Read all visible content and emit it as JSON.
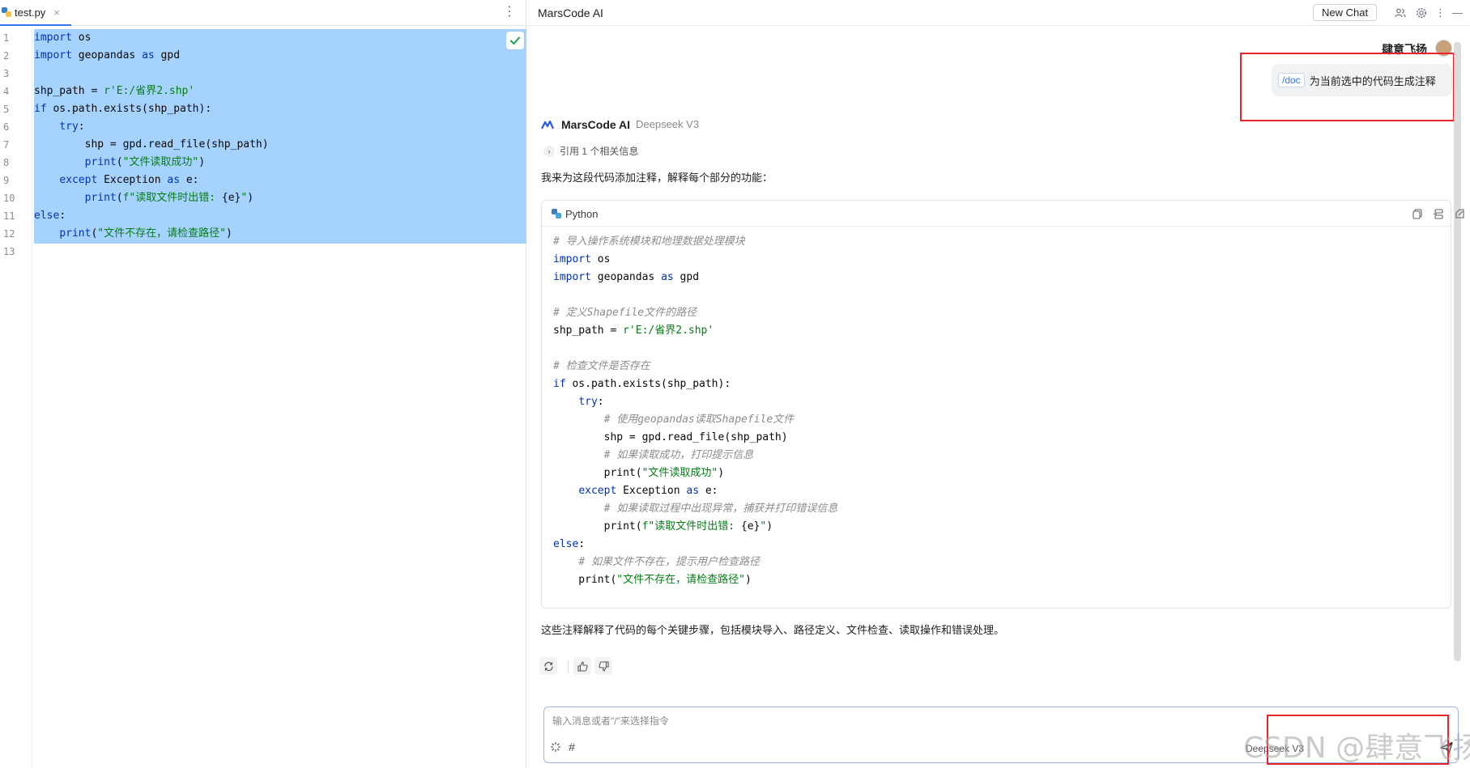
{
  "editor": {
    "tab_label": "test.py",
    "close_glyph": "×",
    "more_glyph": "⋮",
    "line_numbers": [
      "1",
      "2",
      "3",
      "4",
      "5",
      "6",
      "7",
      "8",
      "9",
      "10",
      "11",
      "12",
      "13"
    ],
    "lines": [
      [
        {
          "t": "import",
          "c": "kw"
        },
        {
          "t": " os"
        }
      ],
      [
        {
          "t": "import",
          "c": "kw"
        },
        {
          "t": " geopandas "
        },
        {
          "t": "as",
          "c": "kw"
        },
        {
          "t": " gpd"
        }
      ],
      [],
      [
        {
          "t": "shp_path = "
        },
        {
          "t": "r'E:/省界2.shp'",
          "c": "str"
        }
      ],
      [
        {
          "t": "if",
          "c": "kw"
        },
        {
          "t": " os.path.exists(shp_path):"
        }
      ],
      [
        {
          "t": "    "
        },
        {
          "t": "try",
          "c": "kw"
        },
        {
          "t": ":"
        }
      ],
      [
        {
          "t": "        shp = gpd.read_file(shp_path)"
        }
      ],
      [
        {
          "t": "        "
        },
        {
          "t": "print",
          "c": "kw"
        },
        {
          "t": "("
        },
        {
          "t": "\"文件读取成功\"",
          "c": "str"
        },
        {
          "t": ")"
        }
      ],
      [
        {
          "t": "    "
        },
        {
          "t": "except",
          "c": "kw"
        },
        {
          "t": " Exception "
        },
        {
          "t": "as",
          "c": "kw"
        },
        {
          "t": " e:"
        }
      ],
      [
        {
          "t": "        "
        },
        {
          "t": "print",
          "c": "kw"
        },
        {
          "t": "("
        },
        {
          "t": "f\"读取文件时出错: ",
          "c": "str"
        },
        {
          "t": "{e}"
        },
        {
          "t": "\"",
          "c": "str"
        },
        {
          "t": ")"
        }
      ],
      [
        {
          "t": "else",
          "c": "kw"
        },
        {
          "t": ":"
        }
      ],
      [
        {
          "t": "    "
        },
        {
          "t": "print",
          "c": "kw"
        },
        {
          "t": "("
        },
        {
          "t": "\"文件不存在，请检查路径\"",
          "c": "str"
        },
        {
          "t": ")"
        }
      ],
      []
    ]
  },
  "chat": {
    "panel_title": "MarsCode AI",
    "new_chat_label": "New Chat",
    "header_icons": [
      "people-icon",
      "gear-icon",
      "more-icon",
      "minimize-icon"
    ],
    "user": {
      "name": "肆意飞扬",
      "command_chip": "/doc",
      "message": "为当前选中的代码生成注释"
    },
    "assistant": {
      "name": "MarsCode AI",
      "model": "Deepseek V3",
      "reference_label": "引用 1 个相关信息",
      "intro": "我来为这段代码添加注释，解释每个部分的功能：",
      "code_language": "Python",
      "code_lines": [
        [
          {
            "t": "# 导入操作系统模块和地理数据处理模块",
            "c": "cmt"
          }
        ],
        [
          {
            "t": "import",
            "c": "kw"
          },
          {
            "t": " os"
          }
        ],
        [
          {
            "t": "import",
            "c": "kw"
          },
          {
            "t": " geopandas "
          },
          {
            "t": "as",
            "c": "kw"
          },
          {
            "t": " gpd"
          }
        ],
        [],
        [
          {
            "t": "# 定义Shapefile文件的路径",
            "c": "cmt"
          }
        ],
        [
          {
            "t": "shp_path = "
          },
          {
            "t": "r'E:/省界2.shp'",
            "c": "str"
          }
        ],
        [],
        [
          {
            "t": "# 检查文件是否存在",
            "c": "cmt"
          }
        ],
        [
          {
            "t": "if",
            "c": "kw"
          },
          {
            "t": " os.path.exists(shp_path):"
          }
        ],
        [
          {
            "t": "    "
          },
          {
            "t": "try",
            "c": "kw"
          },
          {
            "t": ":"
          }
        ],
        [
          {
            "t": "        "
          },
          {
            "t": "# 使用geopandas读取Shapefile文件",
            "c": "cmt"
          }
        ],
        [
          {
            "t": "        shp = gpd.read_file(shp_path)"
          }
        ],
        [
          {
            "t": "        "
          },
          {
            "t": "# 如果读取成功，打印提示信息",
            "c": "cmt"
          }
        ],
        [
          {
            "t": "        print("
          },
          {
            "t": "\"文件读取成功\"",
            "c": "str"
          },
          {
            "t": ")"
          }
        ],
        [
          {
            "t": "    "
          },
          {
            "t": "except",
            "c": "kw"
          },
          {
            "t": " Exception "
          },
          {
            "t": "as",
            "c": "kw"
          },
          {
            "t": " e:"
          }
        ],
        [
          {
            "t": "        "
          },
          {
            "t": "# 如果读取过程中出现异常，捕获并打印错误信息",
            "c": "cmt"
          }
        ],
        [
          {
            "t": "        print("
          },
          {
            "t": "f\"读取文件时出错: ",
            "c": "str"
          },
          {
            "t": "{e}"
          },
          {
            "t": "\"",
            "c": "str"
          },
          {
            "t": ")"
          }
        ],
        [
          {
            "t": "else",
            "c": "kw"
          },
          {
            "t": ":"
          }
        ],
        [
          {
            "t": "    "
          },
          {
            "t": "# 如果文件不存在，提示用户检查路径",
            "c": "cmt"
          }
        ],
        [
          {
            "t": "    print("
          },
          {
            "t": "\"文件不存在，请检查路径\"",
            "c": "str"
          },
          {
            "t": ")"
          }
        ]
      ],
      "summary": "这些注释解释了代码的每个关键步骤，包括模块导入、路径定义、文件检查、读取操作和错误处理。"
    },
    "input": {
      "placeholder": "输入消息或者\"/\"来选择指令",
      "model_label": "Deepseek V3"
    }
  },
  "watermark": "CSDN @肆意飞扬",
  "colors": {
    "selection": "#a6d2ff",
    "keyword": "#0033b3",
    "string": "#067d17",
    "comment": "#8c8c8c",
    "highlight_box": "#e8252b",
    "accent": "#3574f0"
  }
}
